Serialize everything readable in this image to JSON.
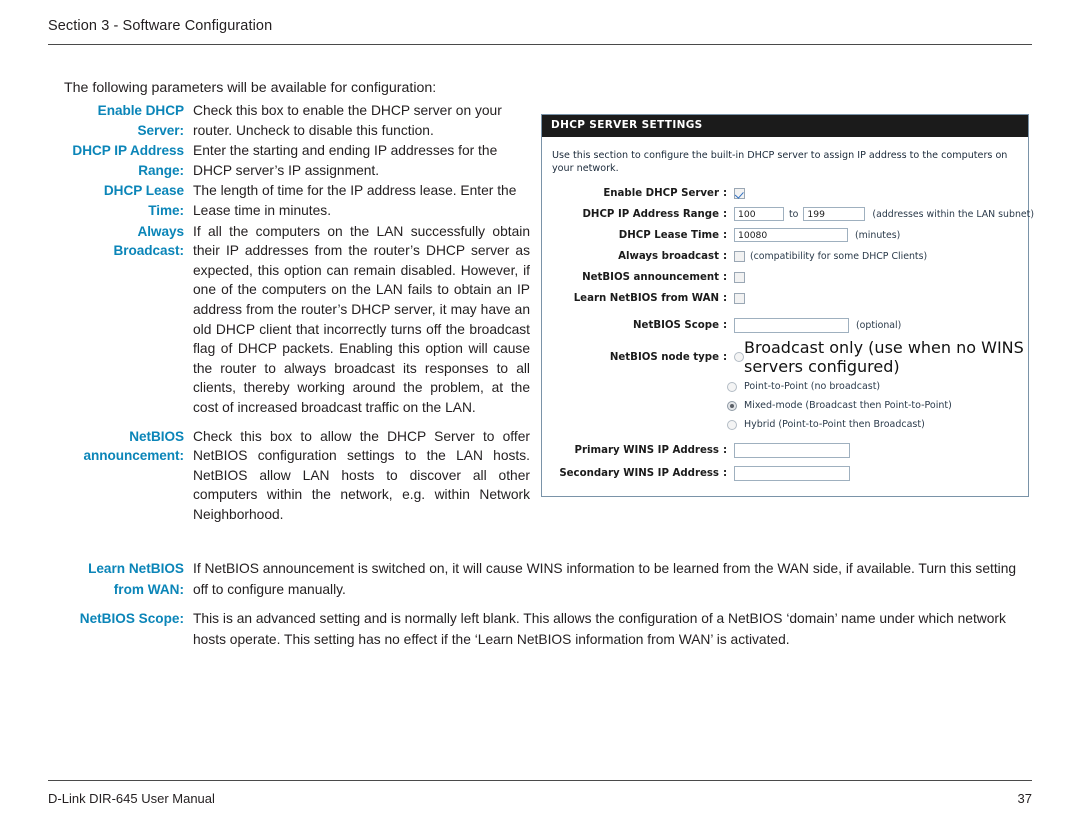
{
  "header": {
    "section_title": "Section 3 - Software Configuration"
  },
  "intro": {
    "text": "The following parameters will be available for configuration:"
  },
  "definitions": [
    {
      "term": "Enable DHCP Server:",
      "term_line1": "Enable DHCP",
      "term_line2": "Server:",
      "desc": "Check this box to enable the DHCP server on your router. Uncheck to disable this function."
    },
    {
      "term": "DHCP IP Address Range:",
      "term_line1": "DHCP IP Address",
      "term_line2": "Range:",
      "desc": "Enter the starting and ending IP addresses for the DHCP server’s IP assignment."
    },
    {
      "term": "DHCP Lease Time:",
      "term_line1": "DHCP Lease",
      "term_line2": "Time:",
      "desc": "The length of time for the IP address lease. Enter the Lease time in minutes."
    },
    {
      "term": "Always Broadcast:",
      "term_line1": "Always",
      "term_line2": "Broadcast:",
      "desc": "If all the computers on the LAN successfully obtain their IP addresses from the router’s DHCP server as expected, this option can remain disabled. However, if one of the computers on the LAN fails to obtain an IP address from the router’s DHCP server, it may have an old DHCP client that incorrectly turns off the broadcast flag of DHCP packets. Enabling this option will cause the router to always broadcast its responses to all clients, thereby working around the problem, at the cost of increased broadcast traffic on the LAN."
    },
    {
      "term": "NetBIOS announcement:",
      "term_line1": "NetBIOS",
      "term_line2": "announcement:",
      "desc": "Check this box to allow the DHCP Server to offer NetBIOS configuration settings to the LAN hosts. NetBIOS allow LAN hosts to discover all other computers within the network, e.g. within Network Neighborhood."
    }
  ],
  "wide_definitions": [
    {
      "term": "Learn NetBIOS from WAN:",
      "term_line1": "Learn NetBIOS",
      "term_line2": "from WAN:",
      "desc": "If NetBIOS announcement is switched on, it will cause WINS information to be learned from the WAN side, if available. Turn this setting off to configure manually."
    },
    {
      "term": "NetBIOS Scope:",
      "term_line1": "NetBIOS Scope:",
      "term_line2": "",
      "desc": "This is an advanced setting and is normally left blank. This allows the configuration of a NetBIOS ‘domain’ name under which network hosts operate. This setting has no effect if the ‘Learn NetBIOS information from WAN’ is activated."
    }
  ],
  "dhcp_panel": {
    "title": "DHCP SERVER SETTINGS",
    "description": "Use this section to configure the built-in DHCP server to assign IP address to the computers on your network.",
    "fields": {
      "enable_dhcp_server": {
        "label": "Enable DHCP Server",
        "colon": ":",
        "checked": true
      },
      "dhcp_ip_address_range": {
        "label": "DHCP IP Address Range",
        "colon": ":",
        "start": "100",
        "to_word": "to",
        "end": "199",
        "hint": "(addresses within the LAN subnet)"
      },
      "dhcp_lease_time": {
        "label": "DHCP Lease Time",
        "colon": ":",
        "value": "10080",
        "hint": "(minutes)"
      },
      "always_broadcast": {
        "label": "Always broadcast",
        "colon": ":",
        "checked": false,
        "hint": "(compatibility for some DHCP Clients)"
      },
      "netbios_announcement": {
        "label": "NetBIOS announcement",
        "colon": ":",
        "checked": false
      },
      "learn_netbios_from_wan": {
        "label": "Learn NetBIOS from WAN",
        "colon": ":",
        "checked": false
      },
      "netbios_scope": {
        "label": "NetBIOS Scope",
        "colon": ":",
        "value": "",
        "hint": "(optional)"
      },
      "netbios_node_type": {
        "label": "NetBIOS node type",
        "colon": ":",
        "selected": "Mixed-mode (Broadcast then Point-to-Point)",
        "options": [
          "Broadcast only (use when no WINS servers configured)",
          "Point-to-Point (no broadcast)",
          "Mixed-mode (Broadcast then Point-to-Point)",
          "Hybrid (Point-to-Point then Broadcast)"
        ]
      },
      "primary_wins_ip": {
        "label": "Primary WINS IP Address",
        "colon": ":",
        "value": ""
      },
      "secondary_wins_ip": {
        "label": "Secondary WINS IP Address",
        "colon": ":",
        "value": ""
      }
    }
  },
  "footer": {
    "manual_title": "D-Link DIR-645 User Manual",
    "page_number": "37"
  },
  "colors": {
    "accent_blue": "#0b85b8",
    "panel_header_bg": "#1b1b1b",
    "panel_border": "#7a93a8",
    "text": "#231f20"
  }
}
